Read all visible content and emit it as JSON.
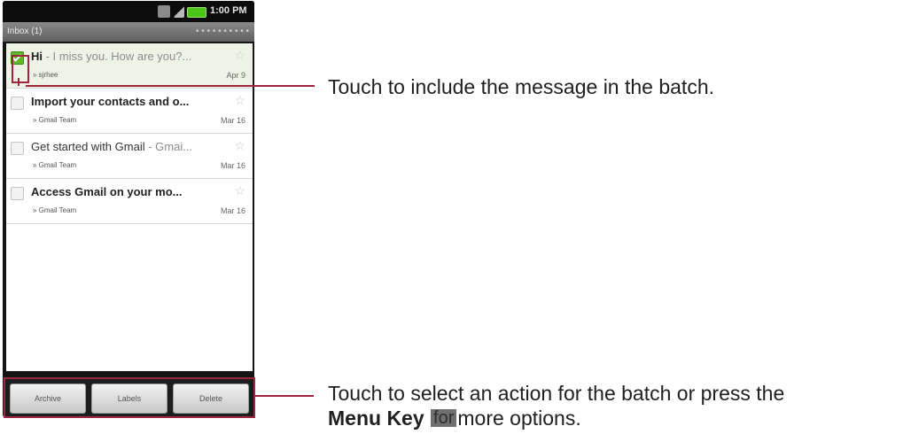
{
  "status_bar": {
    "time": "1:00 PM"
  },
  "title_bar": {
    "label": "Inbox (1)",
    "account": "[blurred account address]"
  },
  "messages": [
    {
      "subject": "Hi",
      "snippet": " - I miss you. How are you?...",
      "sender": "» sjrhee",
      "date": "Apr 9",
      "selected": true
    },
    {
      "subject": "Import your contacts and o...",
      "snippet": "",
      "sender": "» Gmail Team",
      "date": "Mar 16",
      "selected": false
    },
    {
      "subject": "Get started with Gmail",
      "snippet": " - Gmai...",
      "sender": "» Gmail Team",
      "date": "Mar 16",
      "selected": false
    },
    {
      "subject": "Access Gmail on your mo...",
      "snippet": "",
      "sender": "» Gmail Team",
      "date": "Mar 16",
      "selected": false
    }
  ],
  "actions": {
    "archive": "Archive",
    "labels": "Labels",
    "delete": "Delete"
  },
  "annotations": {
    "top": "Touch to include the message in the batch.",
    "bottom_line1": "Touch to select an action for the batch or press the",
    "bottom_menu_key": "Menu Key",
    "bottom_key_glyph": "for",
    "bottom_line2_rest": "more options."
  },
  "colors": {
    "accent": "#a0253f",
    "checkbox": "#5fb82a",
    "battery": "#4cc416"
  }
}
